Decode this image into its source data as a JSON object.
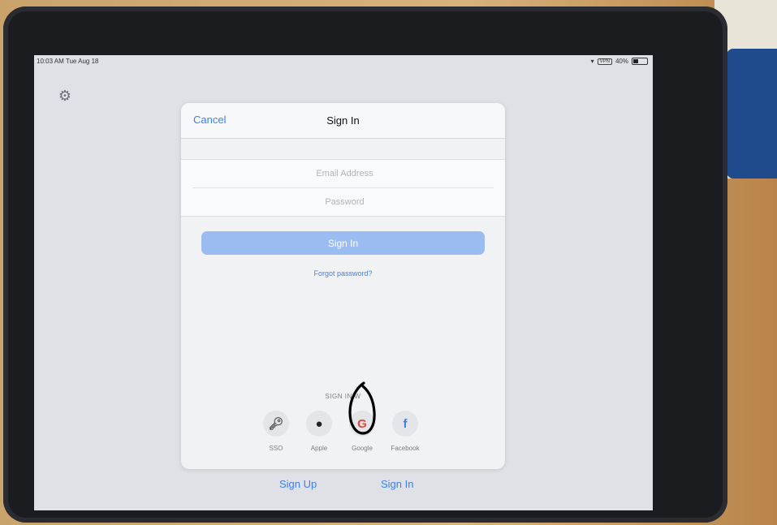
{
  "status_bar": {
    "time_date": "10:03 AM  Tue Aug 18",
    "vpn": "VPN",
    "battery": "40%",
    "battery_level": 0.4
  },
  "modal": {
    "cancel_label": "Cancel",
    "title": "Sign In",
    "email_placeholder": "Email Address",
    "password_placeholder": "Password",
    "signin_button_label": "Sign In",
    "forgot_password_label": "Forgot password?",
    "signin_with_label": "SIGN IN W",
    "social": [
      {
        "label": "SSO",
        "icon": "key-icon",
        "color": "#555555"
      },
      {
        "label": "Apple",
        "icon": "apple-icon",
        "color": "#222222"
      },
      {
        "label": "Google",
        "icon": "google-icon",
        "color": "#e04a3a"
      },
      {
        "label": "Facebook",
        "icon": "facebook-icon",
        "color": "#3f7fe6"
      }
    ]
  },
  "bottom": {
    "sign_up_label": "Sign Up",
    "sign_in_label": "Sign In"
  },
  "colors": {
    "accent": "#3f7fe6",
    "button_fill": "#9bbcf0"
  }
}
